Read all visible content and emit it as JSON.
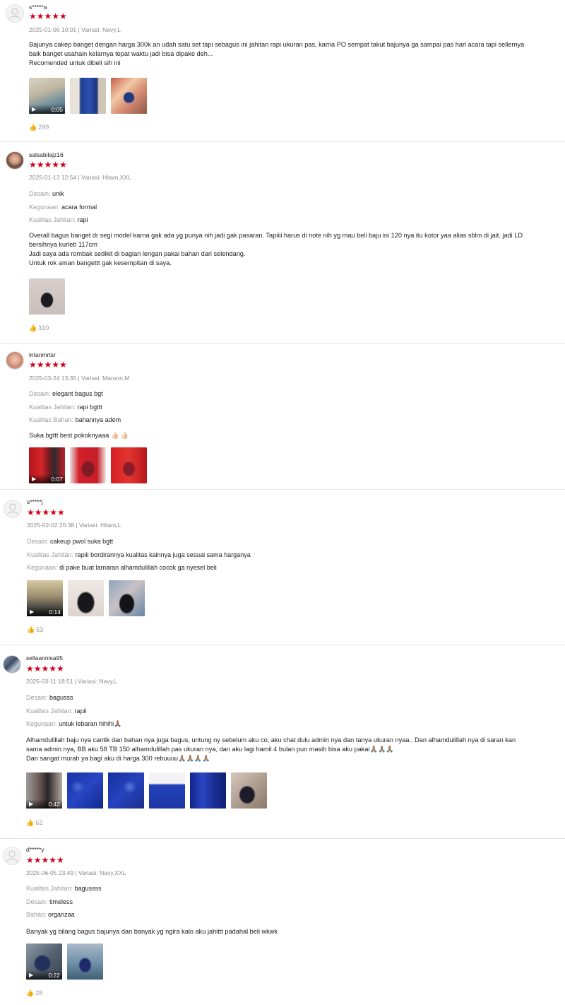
{
  "reviews": [
    {
      "username": "s*****a",
      "avatar": "default-user-icon",
      "rating": 5,
      "stars": "★★★★★",
      "meta": "2025-01-06 10:01 | Variasi: Navy,L",
      "attributes": [],
      "body": [
        "Bajunya cakep banget dengan harga 300k an udah satu set tapi sebagus ini jahitan rapi ukuran pas, karna PO sempat takut bajunya ga sampai pas hari acara tapi sellernya",
        "baik banget usahain kelarnya tepat waktu jadi bisa dipake deh...",
        "Recomended untuk dibeli sih ini"
      ],
      "media": [
        {
          "type": "video",
          "duration": "0:05"
        },
        {
          "type": "image"
        },
        {
          "type": "image"
        }
      ],
      "likes": "299"
    },
    {
      "username": "salsabilajz16",
      "avatar": "user-photo",
      "rating": 5,
      "stars": "★★★★★",
      "meta": "2025-01-13 12:54 | Variasi: Hitam,XXL",
      "attributes": [
        {
          "key": "Desain:",
          "value": "unik"
        },
        {
          "key": "Kegunaan:",
          "value": "acara formal"
        },
        {
          "key": "Kualitas Jahitan:",
          "value": "rapi"
        }
      ],
      "body": [
        "Overall bagus banget dr segi model karna gak ada yg punya nih jadi gak pasaran. Tapiiii harus di note nih yg mau beli baju ini 120 nya itu kotor yaa alias sblm di jait. jadi LD",
        "bersihnya kurleb 117cm",
        "Jadi saya ada rombak sedikit di bagian lengan pakai bahan dari selendang.",
        "Untuk rok aman bangettt gak kesempitan di saya."
      ],
      "media": [
        {
          "type": "image"
        }
      ],
      "likes": "310"
    },
    {
      "username": "intanmrtsr",
      "avatar": "user-photo",
      "rating": 5,
      "stars": "★★★★★",
      "meta": "2025-03-24 13:35 | Variasi: Maroon,M",
      "attributes": [
        {
          "key": "Desain:",
          "value": "elegant bagus bgt"
        },
        {
          "key": "Kualitas Jahitan:",
          "value": "rapi bgttt"
        },
        {
          "key": "Kualitas Bahan:",
          "value": "bahannya adem"
        }
      ],
      "body": [
        "Suka bgttt best pokoknyaaa 👍🏻 👍🏻"
      ],
      "media": [
        {
          "type": "video",
          "duration": "0:07"
        },
        {
          "type": "image"
        },
        {
          "type": "image"
        }
      ],
      "likes": ""
    },
    {
      "username": "s*****j",
      "avatar": "default-user-icon",
      "rating": 5,
      "stars": "★★★★★",
      "meta": "2025-02-02 20:38 | Variasi: Hitam,L",
      "attributes": [
        {
          "key": "Desain:",
          "value": "cakeup pwol suka bgtt"
        },
        {
          "key": "Kualitas Jahitan:",
          "value": "rapiii bordirannya kualitas kainnya juga sesuai sama harganya"
        },
        {
          "key": "Kegunaan:",
          "value": "di pake buat lamaran alhamdulillah cocok ga nyesel beli"
        }
      ],
      "body": [],
      "media": [
        {
          "type": "video",
          "duration": "0:14"
        },
        {
          "type": "image"
        },
        {
          "type": "image"
        }
      ],
      "likes": "53"
    },
    {
      "username": "sellaannisa95",
      "avatar": "user-photo",
      "rating": 5,
      "stars": "★★★★★",
      "meta": "2025-03-11 18:51 | Variasi: Navy,L",
      "attributes": [
        {
          "key": "Desain:",
          "value": "bagusss"
        },
        {
          "key": "Kualitas Jahitan:",
          "value": "rapii"
        },
        {
          "key": "Kegunaan:",
          "value": "untuk lebaran hihihi🙏🏽"
        }
      ],
      "body": [
        "Alhamdulillah baju nya cantik dan bahan nya juga bagus, untung ny sebelum aku co, aku chat dulu admin nya dan tanya ukuran nyaa.. Dan alhamdulillah nya di saran kan",
        "sama admin nya, BB aku 58 TB 150 alhamdulillah pas ukuran nya, dan aku lagi hamil 4 bulan pun masih bisa aku pakai🙏🏽🙏🏽🙏🏽",
        "Dan sangat murah ya bagi aku di harga 300 rebuuuu🙏🏽🙏🏽🙏🏽🙏🏽"
      ],
      "media": [
        {
          "type": "video",
          "duration": "0:42"
        },
        {
          "type": "image"
        },
        {
          "type": "image"
        },
        {
          "type": "image"
        },
        {
          "type": "image"
        },
        {
          "type": "image"
        }
      ],
      "likes": "62"
    },
    {
      "username": "d*****y",
      "avatar": "default-user-icon",
      "rating": 5,
      "stars": "★★★★★",
      "meta": "2025-06-05 23:49 | Variasi: Navy,XXL",
      "attributes": [
        {
          "key": "Kualitas Jahitan:",
          "value": "bagussss"
        },
        {
          "key": "Desain:",
          "value": "timeless"
        },
        {
          "key": "Bahan:",
          "value": "organzaa"
        }
      ],
      "body": [
        "Banyak yg bilang bagus bajunya dan banyak yg ngira kalo aku jahittt padahal beli wkwk"
      ],
      "media": [
        {
          "type": "video",
          "duration": "0:22"
        },
        {
          "type": "image"
        }
      ],
      "likes": "28"
    }
  ],
  "colors": {
    "star": "#d0011b",
    "meta_text": "#8a8a8a",
    "attr_key": "#9a9a9a"
  },
  "icons": {
    "video": "video-camera-icon",
    "like": "thumbs-up-icon",
    "star": "star-icon"
  }
}
